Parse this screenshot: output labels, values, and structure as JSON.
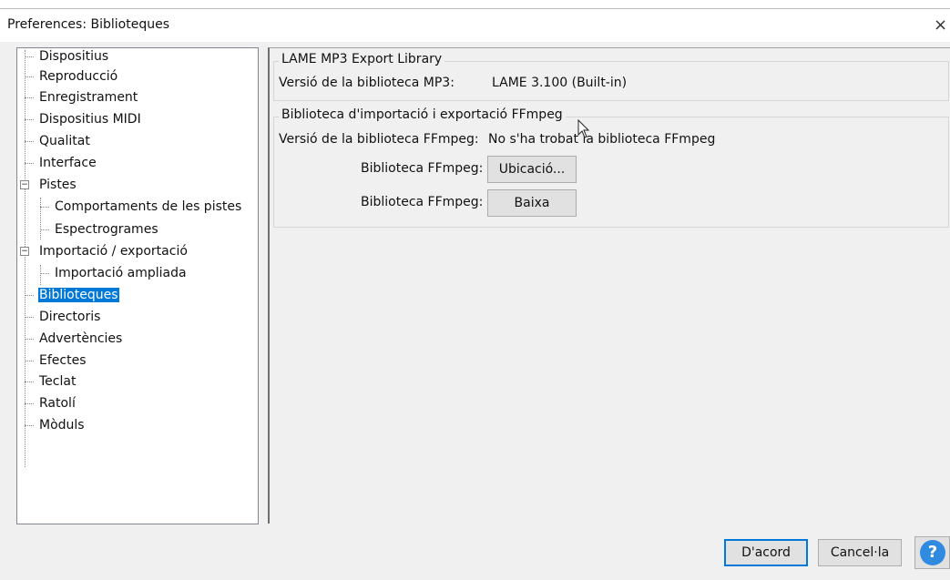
{
  "window": {
    "title": "Preferences: Biblioteques",
    "close_label": "×"
  },
  "tree": {
    "items": [
      {
        "label": "Dispositius"
      },
      {
        "label": "Reproducció"
      },
      {
        "label": "Enregistrament"
      },
      {
        "label": "Dispositius MIDI"
      },
      {
        "label": "Qualitat"
      },
      {
        "label": "Interface"
      },
      {
        "label": "Pistes",
        "expander": "−"
      },
      {
        "label": "Comportaments de les pistes"
      },
      {
        "label": "Espectrogrames"
      },
      {
        "label": "Importació / exportació",
        "expander": "−"
      },
      {
        "label": "Importació ampliada"
      },
      {
        "label": "Biblioteques",
        "selected": true
      },
      {
        "label": "Directoris"
      },
      {
        "label": "Advertències"
      },
      {
        "label": "Efectes"
      },
      {
        "label": "Teclat"
      },
      {
        "label": "Ratolí"
      },
      {
        "label": "Mòduls"
      }
    ]
  },
  "lame": {
    "group_title": "LAME MP3 Export Library",
    "version_label": "Versió de la biblioteca MP3:",
    "version_value": "LAME 3.100 (Built-in)"
  },
  "ffmpeg": {
    "group_title": "Biblioteca d'importació i exportació FFmpeg",
    "version_label": "Versió de la biblioteca FFmpeg:",
    "version_value": "No s'ha trobat la biblioteca FFmpeg",
    "locate_label": "Biblioteca FFmpeg:",
    "locate_button": "Ubicació...",
    "download_label": "Biblioteca FFmpeg:",
    "download_button": "Baixa"
  },
  "footer": {
    "ok_button": "D'acord",
    "cancel_button": "Cancel·la",
    "help_button": "?"
  },
  "colors": {
    "selection": "#0078d7",
    "help": "#2f8ae0"
  }
}
